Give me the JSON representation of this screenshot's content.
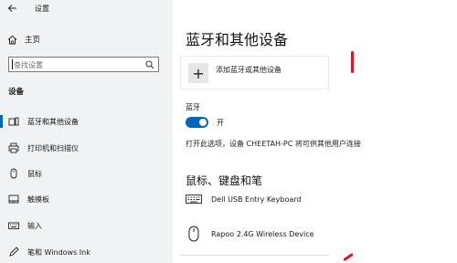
{
  "window": {
    "title": "设置"
  },
  "sidebar": {
    "home_label": "主页",
    "search_placeholder": "查找设置",
    "section_title": "设备",
    "items": [
      {
        "label": "蓝牙和其他设备",
        "icon": "bluetooth-devices-icon",
        "active": true
      },
      {
        "label": "打印机和扫描仪",
        "icon": "printer-icon"
      },
      {
        "label": "鼠标",
        "icon": "mouse-icon"
      },
      {
        "label": "触摸板",
        "icon": "touchpad-icon"
      },
      {
        "label": "输入",
        "icon": "keyboard-icon"
      },
      {
        "label": "笔和 Windows Ink",
        "icon": "pen-icon"
      }
    ]
  },
  "main": {
    "title": "蓝牙和其他设备",
    "add_device_label": "添加蓝牙或其他设备",
    "bluetooth_label": "蓝牙",
    "bluetooth_state": "开",
    "discoverable_text": "打开此选项，设备 CHEETAH-PC 将可供其他用户连接",
    "section_title": "鼠标、键盘和笔",
    "devices": [
      {
        "name": "Dell USB Entry Keyboard",
        "icon": "keyboard-icon"
      },
      {
        "name": "Rapoo 2.4G Wireless Device",
        "icon": "mouse-icon"
      }
    ]
  },
  "colors": {
    "accent": "#0067c0",
    "annotation_red": "#e81123",
    "sidebar_bg": "#f0f2f4"
  }
}
